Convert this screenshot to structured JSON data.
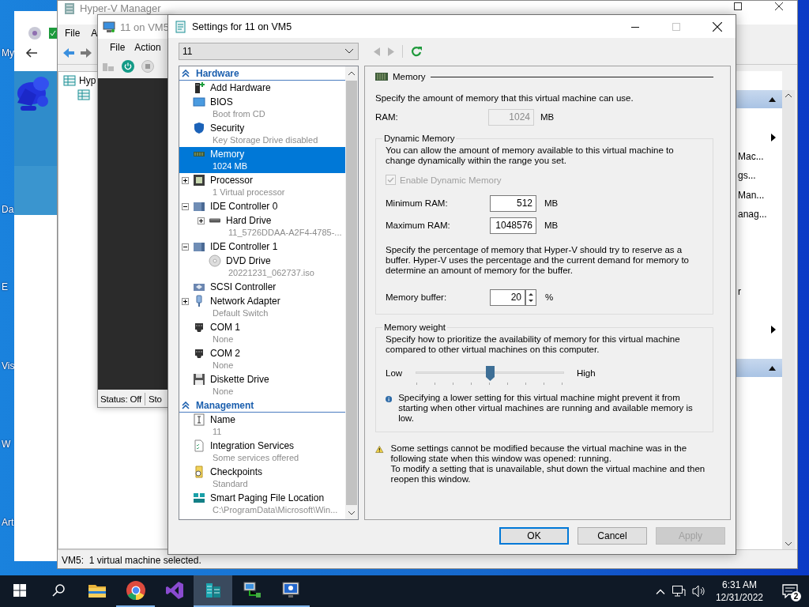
{
  "desktop": {
    "icon_labels": [
      "My",
      "Da",
      "E",
      "Vis",
      "W",
      "Art"
    ]
  },
  "hyperv_manager": {
    "title": "Hyper-V Manager",
    "menu": [
      "File",
      "A"
    ],
    "tree_root": "Hyp",
    "actions": [
      {
        "expanded": true,
        "items": [
          {
            "kind": "item"
          },
          {
            "kind": "submenu"
          },
          {
            "kind": "item",
            "label": "Mac..."
          },
          {
            "kind": "item",
            "label": "gs..."
          },
          {
            "kind": "item",
            "label": "Man..."
          },
          {
            "kind": "item",
            "label": "anag..."
          },
          {
            "kind": "item"
          },
          {
            "kind": "item"
          },
          {
            "kind": "item"
          },
          {
            "kind": "item",
            "label": "r"
          },
          {
            "kind": "item"
          },
          {
            "kind": "submenu"
          },
          {
            "kind": "item"
          }
        ]
      },
      {
        "expanded": true
      }
    ],
    "status_bar": "VM5:  1 virtual machine selected."
  },
  "vm_window": {
    "title": "11 on VM5",
    "menu": [
      "File",
      "Action"
    ],
    "status": [
      "Status: Off",
      "Sto"
    ]
  },
  "settings": {
    "title": "Settings for 11 on VM5",
    "vm_select": "11",
    "tree": {
      "sections": [
        {
          "title": "Hardware",
          "expanded": true,
          "items": [
            {
              "kind": "add-hardware",
              "label": "Add Hardware",
              "selected": false
            },
            {
              "kind": "bios",
              "label": "BIOS",
              "detail": "Boot from CD",
              "selected": false
            },
            {
              "kind": "security",
              "label": "Security",
              "detail": "Key Storage Drive disabled",
              "selected": false
            },
            {
              "kind": "memory",
              "label": "Memory",
              "detail": "1024 MB",
              "selected": true
            },
            {
              "kind": "processor",
              "label": "Processor",
              "detail": "1 Virtual processor",
              "selected": false,
              "expanded": false
            },
            {
              "kind": "ide",
              "label": "IDE Controller 0",
              "selected": false,
              "expanded": true,
              "children": [
                {
                  "kind": "hard-drive",
                  "label": "Hard Drive",
                  "detail": "11_5726DDAA-A2F4-4785-...",
                  "selected": false,
                  "expanded": false
                }
              ]
            },
            {
              "kind": "ide",
              "label": "IDE Controller 1",
              "selected": false,
              "expanded": true,
              "children": [
                {
                  "kind": "dvd",
                  "label": "DVD Drive",
                  "detail": "20221231_062737.iso",
                  "selected": false
                }
              ]
            },
            {
              "kind": "scsi",
              "label": "SCSI Controller",
              "selected": false
            },
            {
              "kind": "network",
              "label": "Network Adapter",
              "detail": "Default Switch",
              "selected": false,
              "expanded": false
            },
            {
              "kind": "com",
              "label": "COM 1",
              "detail": "None",
              "selected": false
            },
            {
              "kind": "com",
              "label": "COM 2",
              "detail": "None",
              "selected": false
            },
            {
              "kind": "diskette",
              "label": "Diskette Drive",
              "detail": "None",
              "selected": false
            }
          ]
        },
        {
          "title": "Management",
          "expanded": true,
          "items": [
            {
              "kind": "name",
              "label": "Name",
              "detail": "11",
              "selected": false
            },
            {
              "kind": "integration",
              "label": "Integration Services",
              "detail": "Some services offered",
              "selected": false
            },
            {
              "kind": "checkpoints",
              "label": "Checkpoints",
              "detail": "Standard",
              "selected": false
            },
            {
              "kind": "paging",
              "label": "Smart Paging File Location",
              "detail": "C:\\ProgramData\\Microsoft\\Win...",
              "selected": false
            }
          ]
        }
      ]
    },
    "memory": {
      "title": "Memory",
      "intro": "Specify the amount of memory that this virtual machine can use.",
      "ram": {
        "label": "RAM:",
        "value": "1024",
        "unit": "MB",
        "disabled": true
      },
      "dynamic": {
        "title": "Dynamic Memory",
        "description": "You can allow the amount of memory available to this virtual machine to change dynamically within the range you set.",
        "enable": {
          "label": "Enable Dynamic Memory",
          "checked": true,
          "disabled": true
        },
        "fields": [
          {
            "label": "Minimum RAM:",
            "value": "512",
            "unit": "MB"
          },
          {
            "label": "Maximum RAM:",
            "value": "1048576",
            "unit": "MB"
          }
        ],
        "buffer_description": "Specify the percentage of memory that Hyper-V should try to reserve as a buffer. Hyper-V uses the percentage and the current demand for memory to determine an amount of memory for the buffer.",
        "buffer": {
          "label": "Memory buffer:",
          "value": "20",
          "unit": "%"
        }
      },
      "weight": {
        "title": "Memory weight",
        "description": "Specify how to prioritize the availability of memory for this virtual machine compared to other virtual machines on this computer.",
        "low": "Low",
        "high": "High",
        "level": 0.5,
        "info": "Specifying a lower setting for this virtual machine might prevent it from starting when other virtual machines are running and available memory is low."
      },
      "warning": [
        "Some settings cannot be modified because the virtual machine was in the following state when this window was opened: running.",
        "To modify a setting that is unavailable, shut down the virtual machine and then reopen this window."
      ]
    },
    "buttons": [
      {
        "label": "OK",
        "default": true,
        "disabled": false
      },
      {
        "label": "Cancel",
        "default": false,
        "disabled": false
      },
      {
        "label": "Apply",
        "default": false,
        "disabled": true
      }
    ]
  },
  "taskbar": {
    "apps": [
      {
        "kind": "folder",
        "running": false,
        "active": false
      },
      {
        "kind": "browser",
        "running": true,
        "active": false
      },
      {
        "kind": "studio",
        "running": false,
        "active": false
      },
      {
        "kind": "hyperv",
        "running": true,
        "active": true
      },
      {
        "kind": "network-computer",
        "running": true,
        "active": false
      },
      {
        "kind": "remote-monitor",
        "running": true,
        "active": false
      }
    ],
    "time": "6:31 AM",
    "date": "12/31/2022",
    "notifications": "2"
  }
}
